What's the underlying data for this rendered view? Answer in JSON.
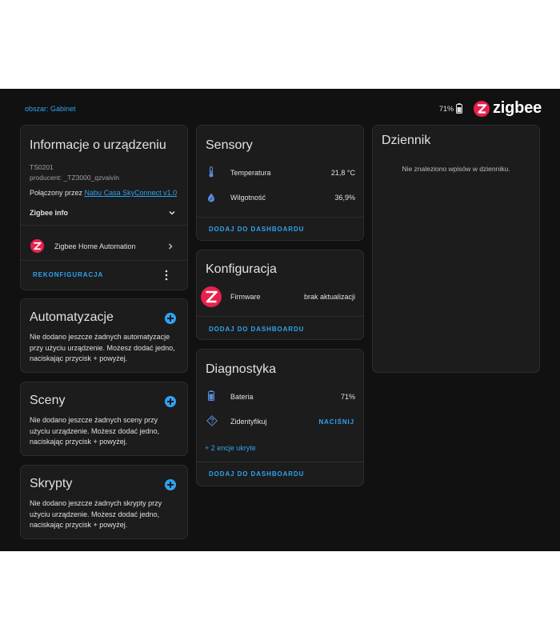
{
  "topbar": {
    "breadcrumb": "obszar: Gabinet",
    "battery_pct": "71%",
    "brand": "zigbee"
  },
  "device_info": {
    "title": "Informacje o urządzeniu",
    "model": "TS0201",
    "manufacturer": "producent: _TZ3000_qzvaivin",
    "connected_prefix": "Połączony przez ",
    "connected_link": "Nabu Casa SkyConnect v1.0",
    "zigbee_info": "Zigbee info",
    "integration": "Zigbee Home Automation",
    "reconfigure": "REKONFIGURACJA"
  },
  "automations": {
    "title": "Automatyzacje",
    "text": "Nie dodano jeszcze żadnych automatyzacje przy użyciu urządzenie. Możesz dodać jedno, naciskając przycisk + powyżej."
  },
  "scenes": {
    "title": "Sceny",
    "text": "Nie dodano jeszcze żadnych sceny przy użyciu urządzenie. Możesz dodać jedno, naciskając przycisk + powyżej."
  },
  "scripts": {
    "title": "Skrypty",
    "text": "Nie dodano jeszcze żadnych skrypty przy użyciu urządzenie. Możesz dodać jedno, naciskając przycisk + powyżej."
  },
  "sensors": {
    "title": "Sensory",
    "rows": [
      {
        "label": "Temperatura",
        "value": "21,8 °C",
        "icon": "thermometer-icon"
      },
      {
        "label": "Wilgotność",
        "value": "36,9%",
        "icon": "water-percent-icon"
      }
    ],
    "add_dashboard": "DODAJ DO DASHBOARDU"
  },
  "configuration": {
    "title": "Konfiguracja",
    "firmware_label": "Firmware",
    "firmware_value": "brak aktualizacji",
    "add_dashboard": "DODAJ DO DASHBOARDU"
  },
  "diagnostics": {
    "title": "Diagnostyka",
    "battery_label": "Bateria",
    "battery_value": "71%",
    "identify_label": "Zidentyfikuj",
    "identify_action": "NACIŚNIJ",
    "hidden_entities": "+ 2 encje ukryte",
    "add_dashboard": "DODAJ DO DASHBOARDU"
  },
  "logbook": {
    "title": "Dziennik",
    "empty": "Nie znaleziono wpisów w dzienniku."
  },
  "colors": {
    "accent": "#2ea3f2",
    "zigbee_red": "#e8204d",
    "background": "#111111",
    "card": "#1c1c1c"
  }
}
